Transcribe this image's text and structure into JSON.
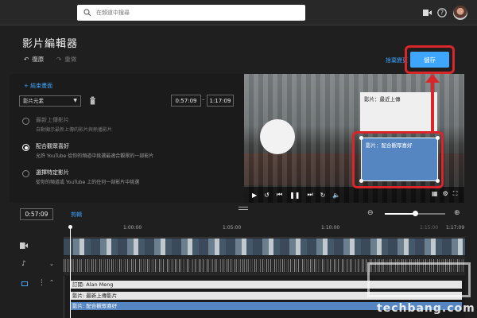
{
  "search": {
    "placeholder": "在頻道中搜尋"
  },
  "editor": {
    "title": "影片編輯器",
    "undo_label": "復原",
    "redo_label": "重做",
    "discard_label": "捨棄變更",
    "save_label": "儲存"
  },
  "end_screen": {
    "add_label": "+ 結束畫面",
    "element_select": "影片元素",
    "start_time": "0:57:09",
    "end_time": "1:17:09",
    "options": [
      {
        "title": "最新上傳影片",
        "desc": "自動顯示最新上傳的影片與熱播影片",
        "selected": false,
        "enabled": false
      },
      {
        "title": "配合觀眾喜好",
        "desc": "允許 YouTube 從你的頻道中挑選最適合觀眾的一部影片",
        "selected": true,
        "enabled": true
      },
      {
        "title": "選擇特定影片",
        "desc": "從你的頻道或 YouTube 上的任何一部影片中挑選",
        "selected": false,
        "enabled": true
      }
    ]
  },
  "preview": {
    "card_latest": "影片：最近上傳",
    "card_recommended": "影片：配合觀眾喜好"
  },
  "timeline": {
    "current_time": "0:57:09",
    "cut_label": "剪輯",
    "ticks": [
      "1:00:00",
      "1:05:00",
      "1:10:00",
      "1:15:00",
      "1:17:09"
    ],
    "zoom_level": 0.5,
    "lanes": {
      "subscribe": "訂閱: Alan Meng",
      "latest": "影片: 最新上傳影片",
      "recommended": "影片: 配合觀眾喜好"
    }
  },
  "watermark": {
    "text": "techbang.com"
  },
  "colors": {
    "accent": "#3ea6ff",
    "highlight": "#d9262b",
    "card_blue": "#5586c1"
  }
}
